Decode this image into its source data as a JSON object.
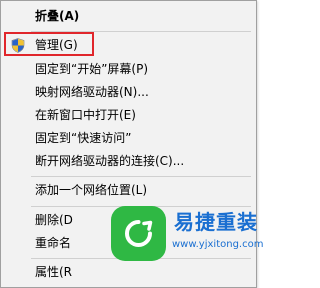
{
  "menu": {
    "items": [
      {
        "label": "折叠(A)"
      },
      {
        "label": "管理(G)"
      },
      {
        "label": "固定到“开始”屏幕(P)"
      },
      {
        "label": "映射网络驱动器(N)..."
      },
      {
        "label": "在新窗口中打开(E)"
      },
      {
        "label": "固定到“快速访问”"
      },
      {
        "label": "断开网络驱动器的连接(C)..."
      },
      {
        "label": "添加一个网络位置(L)"
      },
      {
        "label": "删除(D"
      },
      {
        "label": "重命名"
      },
      {
        "label": "属性(R"
      }
    ]
  },
  "watermark": {
    "title": "易捷重装",
    "url": "www.yjxitong.com"
  },
  "colors": {
    "menu_bg": "#f2f2f2",
    "highlight_border": "#e0262b",
    "watermark_green": "#2fb844",
    "watermark_blue": "#1a6fd1"
  }
}
